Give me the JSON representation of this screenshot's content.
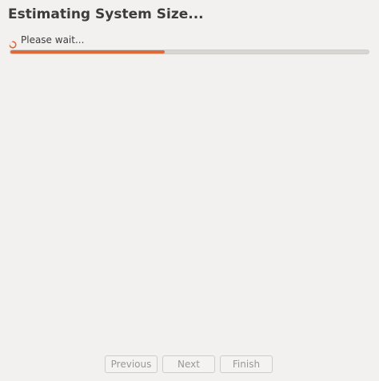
{
  "window": {
    "title": "Estimating System Size..."
  },
  "status": {
    "text": "Please wait...",
    "icon": "spinner-icon"
  },
  "progress": {
    "fraction": 0.43
  },
  "buttons": {
    "previous_label": "Previous",
    "next_label": "Next",
    "finish_label": "Finish"
  },
  "colors": {
    "accent": "#e0693a",
    "background": "#f2f1f0",
    "track": "#d8d6d3"
  }
}
